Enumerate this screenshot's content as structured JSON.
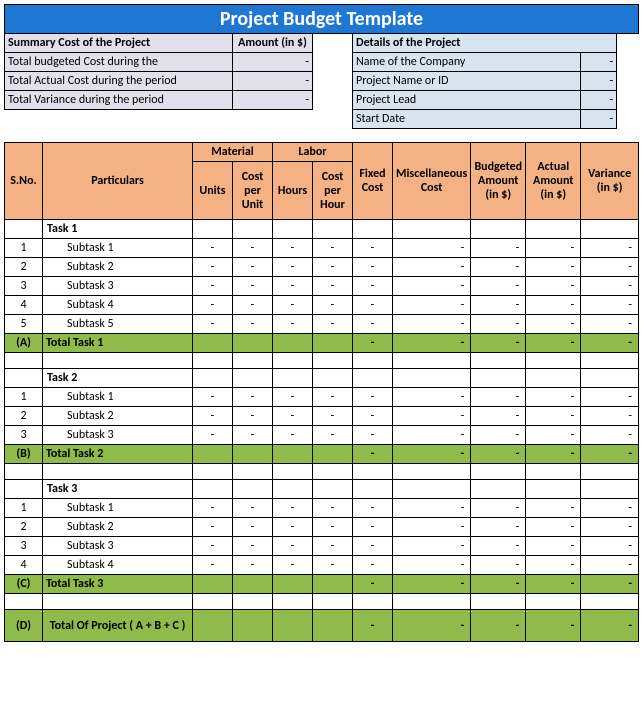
{
  "title": "Project Budget Template",
  "summary": {
    "header": "Summary Cost of the Project",
    "amount_header": "Amount (in $)",
    "rows": [
      {
        "label": "Total budgeted Cost during the",
        "value": "-"
      },
      {
        "label": "Total Actual Cost during the period",
        "value": "-"
      },
      {
        "label": "Total Variance during the period",
        "value": "-"
      }
    ]
  },
  "details": {
    "header": "Details of the Project",
    "rows": [
      {
        "label": "Name of the Company",
        "value": "-"
      },
      {
        "label": "Project Name or ID",
        "value": "-"
      },
      {
        "label": "Project Lead",
        "value": "-"
      },
      {
        "label": "Start Date",
        "value": "-"
      }
    ]
  },
  "columns": {
    "sno": "S.No.",
    "particulars": "Particulars",
    "material": "Material",
    "material_units": "Units",
    "material_cpu": "Cost per Unit",
    "labor": "Labor",
    "labor_hours": "Hours",
    "labor_cph": "Cost per Hour",
    "fixed": "Fixed Cost",
    "misc": "Miscellaneous Cost",
    "budgeted": "Budgeted Amount (in $)",
    "actual": "Actual Amount (in $)",
    "variance": "Variance (in $)"
  },
  "dash": "-",
  "tasks": [
    {
      "name": "Task 1",
      "code": "(A)",
      "total_label": "Total Task 1",
      "subs": [
        "Subtask 1",
        "Subtask 2",
        "Subtask 3",
        "Subtask 4",
        "Subtask 5"
      ]
    },
    {
      "name": "Task 2",
      "code": "(B)",
      "total_label": "Total Task 2",
      "subs": [
        "Subtask 1",
        "Subtask 2",
        "Subtask 3"
      ]
    },
    {
      "name": "Task 3",
      "code": "(C)",
      "total_label": "Total Task 3",
      "subs": [
        "Subtask 1",
        "Subtask 2",
        "Subtask 3",
        "Subtask 4"
      ]
    }
  ],
  "grand": {
    "code": "(D)",
    "label": "Total Of Project ( A + B + C )"
  }
}
